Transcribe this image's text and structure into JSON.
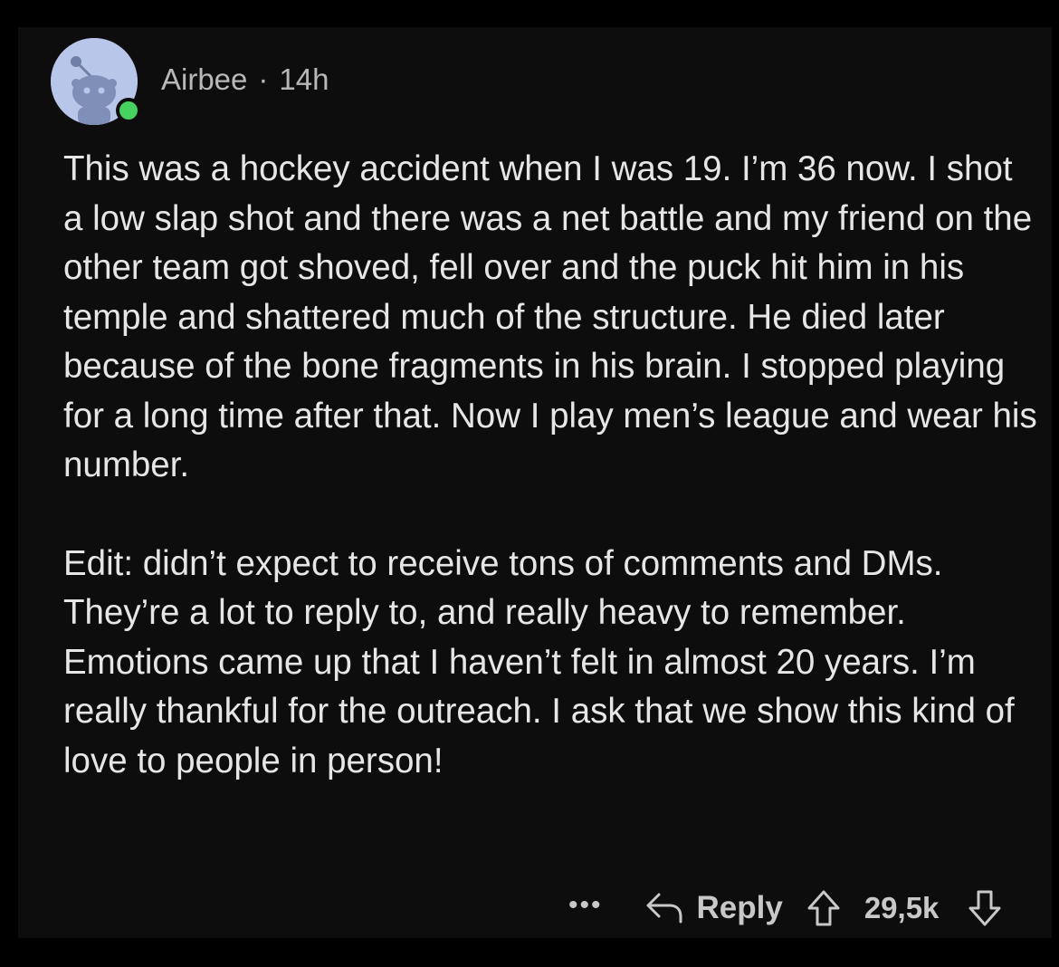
{
  "comment": {
    "author": "Airbee",
    "separator": "·",
    "age": "14h",
    "paragraphs": [
      "This was a hockey accident when I was 19. I’m 36 now. I shot a low slap shot and there was a net battle and my friend on the other team got shoved, fell over and the puck hit him in his temple and shattered much of the structure. He died later because of the bone fragments in his brain. I stopped playing for a long time after that. Now I play men’s league and wear his number.",
      "Edit: didn’t expect to receive tons of comments and DMs. They’re a lot to reply to, and really heavy to remember. Emotions came up that I haven’t felt in almost 20 years. I’m really thankful for the outreach. I ask that we show this kind of love to people in person!"
    ]
  },
  "actions": {
    "more_label": "•••",
    "reply_label": "Reply",
    "score": "29,5k"
  },
  "icons": {
    "avatar": "reddit-snoo-avatar-icon",
    "online": "online-status-icon",
    "reply": "reply-arrow-icon",
    "upvote": "upvote-arrow-icon",
    "downvote": "downvote-arrow-icon"
  },
  "colors": {
    "background": "#0d0d0d",
    "text": "#e6e6e6",
    "meta": "#b8b8b8",
    "online": "#46d160",
    "avatar_bg": "#b8c6ea"
  }
}
